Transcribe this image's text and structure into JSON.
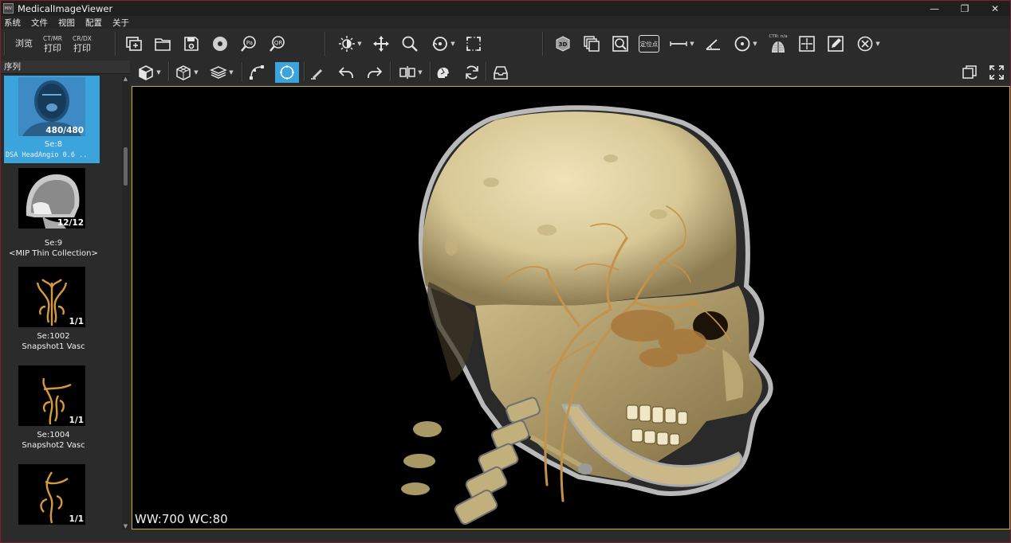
{
  "window": {
    "title": "MedicalImageViewer",
    "icon_text": "MIV",
    "buttons": {
      "minimize": "—",
      "maximize": "❐",
      "close": "✕"
    }
  },
  "menubar": {
    "items": [
      {
        "label": "系统"
      },
      {
        "label": "文件"
      },
      {
        "label": "视图"
      },
      {
        "label": "配置"
      },
      {
        "label": "关于"
      }
    ]
  },
  "toolbar1": {
    "browse_label": "浏览",
    "ctmr_caption": "CT/MR",
    "ctmr_label": "打印",
    "crdx_caption": "CR/DX",
    "crdx_label": "打印",
    "pa_icon_text": "Pa",
    "qr_icon_text": "QR",
    "volume_3d_text": "3D",
    "locate_label": "定位点",
    "ctr_caption": "CTR: n/a"
  },
  "left_panel": {
    "header": "序列",
    "series": [
      {
        "count": "480/480",
        "series_label": "Se:8",
        "description": "DSA  HeadAngio  0.6  ..",
        "selected": true
      },
      {
        "count": "12/12",
        "series_label": "Se:9",
        "description": "<MIP Thin Collection>",
        "selected": false
      },
      {
        "count": "1/1",
        "series_label": "Se:1002",
        "description": "Snapshot1 Vasc",
        "selected": false
      },
      {
        "count": "1/1",
        "series_label": "Se:1004",
        "description": "Snapshot2 Vasc",
        "selected": false
      },
      {
        "count": "1/1",
        "series_label": "",
        "description": "",
        "selected": false
      }
    ]
  },
  "viewport": {
    "window_level": "WW:700 WC:80"
  },
  "colors": {
    "accent": "#3ba4dc",
    "viewport_border": "#c8b23c",
    "window_border": "#7a2230"
  }
}
